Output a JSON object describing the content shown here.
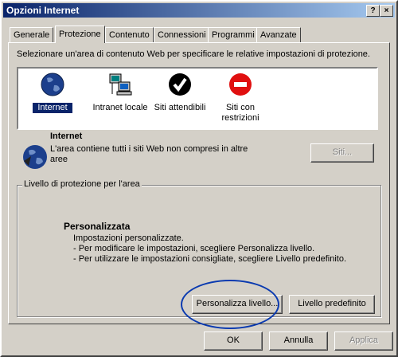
{
  "window": {
    "title": "Opzioni Internet",
    "help_button": "?",
    "close_button": "×"
  },
  "tabs": [
    {
      "label": "Generale"
    },
    {
      "label": "Protezione"
    },
    {
      "label": "Contenuto"
    },
    {
      "label": "Connessioni"
    },
    {
      "label": "Programmi"
    },
    {
      "label": "Avanzate"
    }
  ],
  "active_tab": "Protezione",
  "intro_text": "Selezionare un'area di contenuto Web per specificare le relative impostazioni di protezione.",
  "zones": [
    {
      "label": "Internet",
      "icon": "globe-icon",
      "selected": true
    },
    {
      "label": "Intranet locale",
      "icon": "network-computer-icon"
    },
    {
      "label": "Siti attendibili",
      "icon": "checkmark-icon"
    },
    {
      "label": "Siti con restrizioni",
      "icon": "restricted-icon"
    }
  ],
  "zone_info": {
    "title": "Internet",
    "description": "L'area contiene tutti i siti Web non compresi in altre aree",
    "sites_button": "Siti..."
  },
  "security_level": {
    "group_label": "Livello di protezione per l'area",
    "title": "Personalizzata",
    "lines": [
      "Impostazioni personalizzate.",
      "- Per modificare le impostazioni, scegliere Personalizza livello.",
      "- Per utilizzare le impostazioni consigliate, scegliere Livello predefinito."
    ],
    "custom_button": "Personalizza livello...",
    "default_button": "Livello predefinito"
  },
  "dialog_buttons": {
    "ok": "OK",
    "cancel": "Annulla",
    "apply": "Applica"
  },
  "colors": {
    "face": "#d4d0c8",
    "title_start": "#0a246a",
    "title_end": "#a6caf0",
    "highlight_oval": "#0a3ab0"
  }
}
